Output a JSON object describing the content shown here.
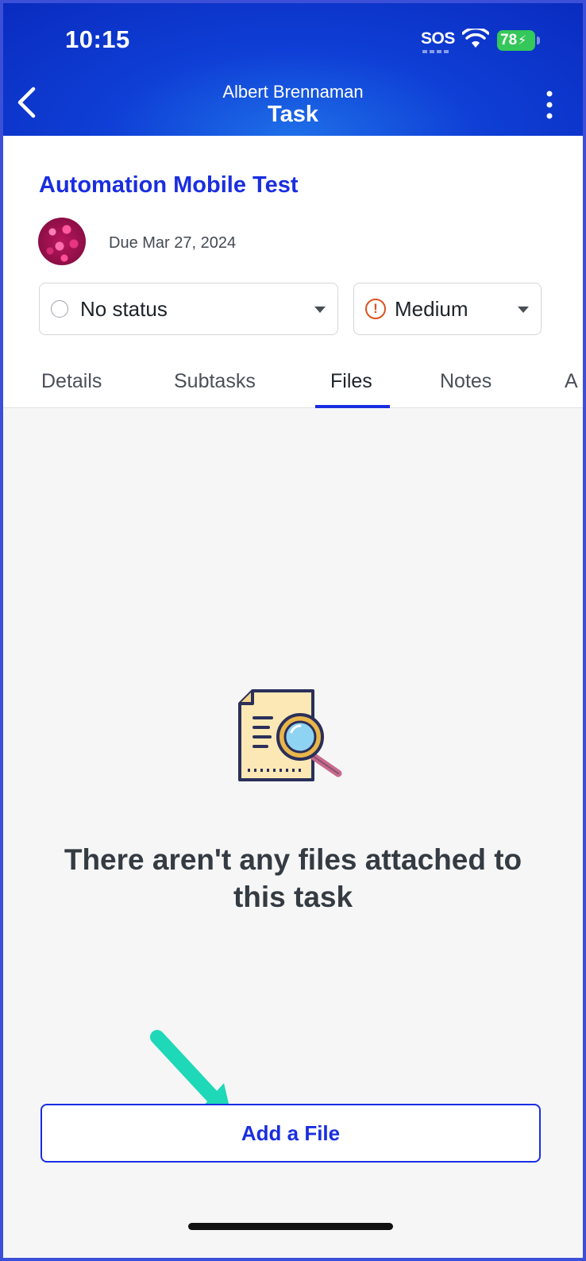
{
  "status_bar": {
    "time": "10:15",
    "sos": "SOS",
    "battery": "78"
  },
  "header": {
    "subtitle": "Albert Brennaman",
    "title": "Task"
  },
  "task": {
    "title": "Automation Mobile Test",
    "due": "Due Mar 27, 2024"
  },
  "status_select": {
    "value": "No status"
  },
  "priority_select": {
    "value": "Medium",
    "color": "#d9531e"
  },
  "tabs": [
    {
      "label": "Details"
    },
    {
      "label": "Subtasks"
    },
    {
      "label": "Files",
      "active": true
    },
    {
      "label": "Notes"
    },
    {
      "label": "A"
    }
  ],
  "empty_state": {
    "message": "There aren't any files attached to this task"
  },
  "add_file_button": {
    "label": "Add a File"
  },
  "colors": {
    "accent": "#1a2ee0",
    "header": "#0f3fd6",
    "arrow": "#1fd8b8"
  }
}
